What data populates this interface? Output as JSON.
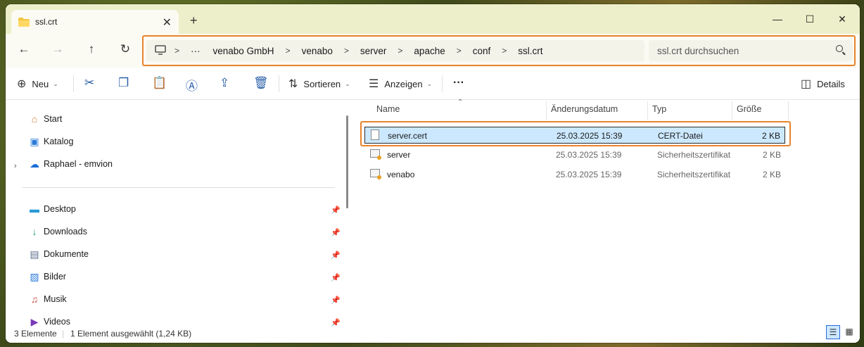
{
  "tab": {
    "title": "ssl.crt",
    "close": "✕",
    "new_tab": "+"
  },
  "window_controls": {
    "minimize": "—",
    "maximize": "☐",
    "close": "✕"
  },
  "nav": {
    "back": "←",
    "forward": "→",
    "up": "↑",
    "refresh": "↻",
    "breadcrumb": [
      "venabo GmbH",
      "venabo",
      "server",
      "apache",
      "conf",
      "ssl.crt"
    ],
    "overflow": "···",
    "search_placeholder": "ssl.crt durchsuchen"
  },
  "commands": {
    "new": "Neu",
    "sort": "Sortieren",
    "view": "Anzeigen",
    "more": "···",
    "details": "Details"
  },
  "sidebar": {
    "items": [
      {
        "label": "Start",
        "icon": "home-icon"
      },
      {
        "label": "Katalog",
        "icon": "gallery-icon"
      },
      {
        "label": "Raphael - emvion",
        "icon": "cloud-icon"
      },
      {
        "label": "Desktop",
        "icon": "desktop-icon"
      },
      {
        "label": "Downloads",
        "icon": "download-icon"
      },
      {
        "label": "Dokumente",
        "icon": "document-icon"
      },
      {
        "label": "Bilder",
        "icon": "pictures-icon"
      },
      {
        "label": "Musik",
        "icon": "music-icon"
      },
      {
        "label": "Videos",
        "icon": "video-icon"
      }
    ]
  },
  "columns": {
    "name": "Name",
    "date": "Änderungsdatum",
    "type": "Typ",
    "size": "Größe"
  },
  "files": [
    {
      "name": "server.cert",
      "date": "25.03.2025 15:39",
      "type": "CERT-Datei",
      "size": "2 KB",
      "selected": true
    },
    {
      "name": "server",
      "date": "25.03.2025 15:39",
      "type": "Sicherheitszertifikat",
      "size": "2 KB",
      "selected": false
    },
    {
      "name": "venabo",
      "date": "25.03.2025 15:39",
      "type": "Sicherheitszertifikat",
      "size": "2 KB",
      "selected": false
    }
  ],
  "status": {
    "count": "3 Elemente",
    "selection": "1 Element ausgewählt (1,24 KB)"
  },
  "colors": {
    "accent": "#e8832b",
    "selection": "#cce8ff",
    "titlebar": "#ecefc9"
  }
}
